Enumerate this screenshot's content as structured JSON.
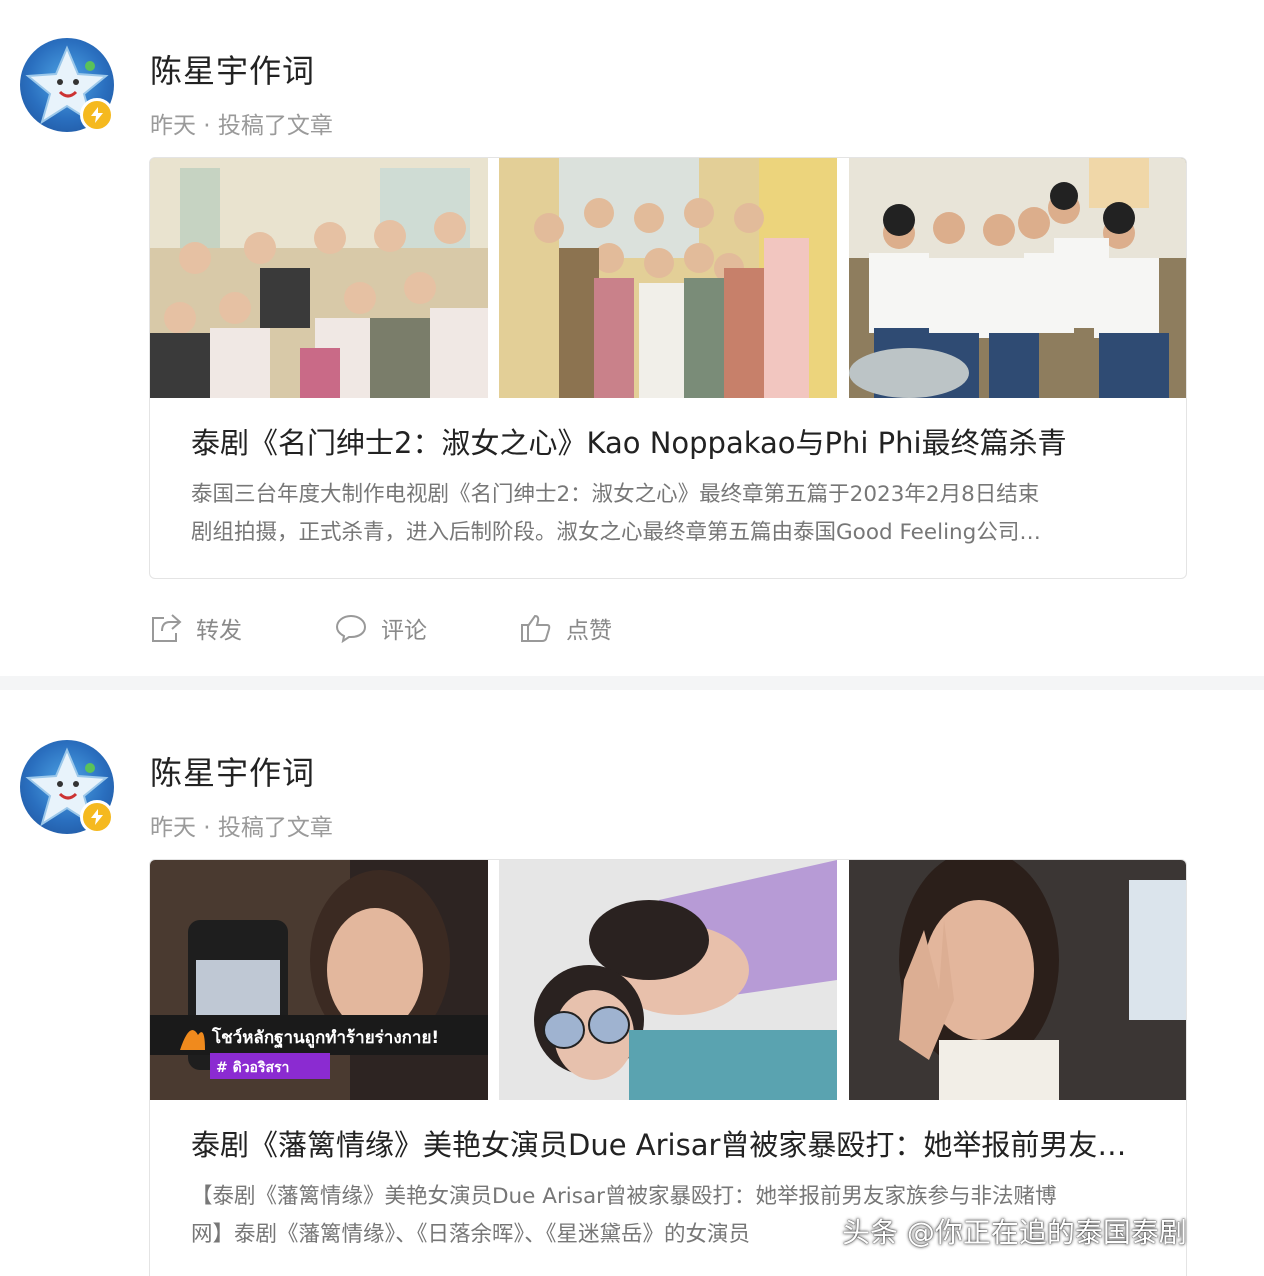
{
  "posts": [
    {
      "author": "陈星宇作词",
      "meta": "昨天 · 投稿了文章",
      "title": "泰剧《名门绅士2：淑女之心》Kao Noppakao与Phi Phi最终篇杀青",
      "desc_lines": [
        "泰国三台年度大制作电视剧《名门绅士2：淑女之心》最终章第五篇于2023年2月8日结束",
        "剧组拍摄，正式杀青，进入后制阶段。淑女之心最终章第五篇由泰国Good Feeling公司…"
      ],
      "actions": {
        "share": "转发",
        "comment": "评论",
        "like": "点赞"
      }
    },
    {
      "author": "陈星宇作词",
      "meta": "昨天 · 投稿了文章",
      "title": "泰剧《藩篱情缘》美艳女演员Due Arisar曾被家暴殴打：她举报前男友家族",
      "overlay_text": "โชว์หลักฐานถูกทำร้ายร่างกาย!",
      "overlay_tag": "# ดิวอริสรา",
      "desc_lines": [
        "【泰剧《藩篱情缘》美艳女演员Due Arisar曾被家暴殴打：她举报前男友家族参与非法赌博",
        "网】泰剧《藩篱情缘》、《日落余晖》、《星迷黛岳》的女演员"
      ]
    }
  ],
  "watermark": "头条 @你正在追的泰国泰剧",
  "colors": {
    "page_bg": "#f4f5f6",
    "badge": "#f5b91f",
    "avatar": "#2a6fbf",
    "muted": "#9a9a9a"
  }
}
